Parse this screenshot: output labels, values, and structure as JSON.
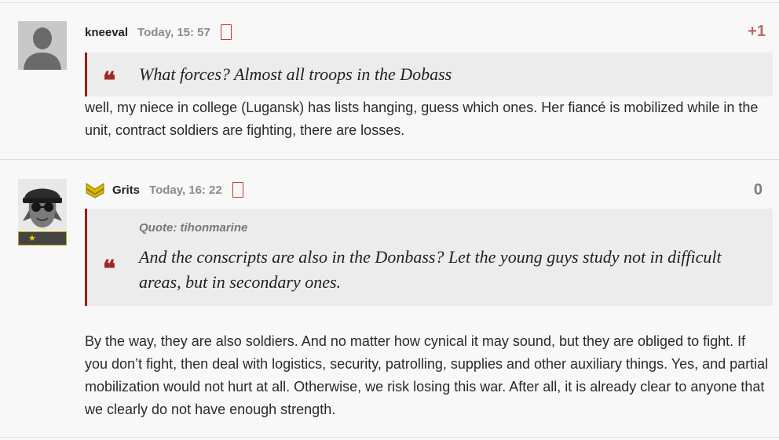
{
  "comments": [
    {
      "username": "kneeval",
      "timestamp": "Today, 15: 57",
      "rating": "+1",
      "quote": {
        "source": "",
        "text": "What forces? Almost all troops in the Dobass"
      },
      "body": "well, my niece in college (Lugansk) has lists hanging, guess which ones. Her fiancé is mobilized while in the unit, contract soldiers are fighting, there are losses."
    },
    {
      "username": "Grits",
      "timestamp": "Today, 16: 22",
      "rating": "0",
      "quote": {
        "source": "Quote: tihonmarine",
        "text": "And the conscripts are also in the Donbass? Let the young guys study not in difficult areas, but in secondary ones."
      },
      "body": "By the way, they are also soldiers. And no matter how cynical it may sound, but they are obliged to fight. If you don’t fight, then deal with logistics, security, patrolling, supplies and other auxiliary things. Yes, and partial mobilization would not hurt at all. Otherwise, we risk losing this war. After all, it is already clear to anyone that we clearly do not have enough strength."
    }
  ],
  "icons": {
    "quote_mark": "❝",
    "rank_star": "★",
    "flag": "report-flag-icon"
  },
  "colors": {
    "quote_accent": "#9c1c1c",
    "positive_rating": "#b56a6a",
    "neutral_rating": "#7d7d7d",
    "rank_gold": "#d8b800"
  }
}
